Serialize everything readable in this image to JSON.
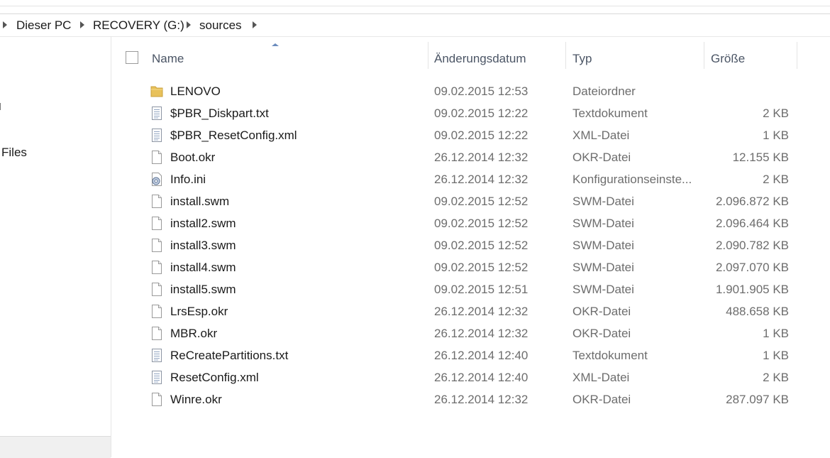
{
  "breadcrumb": [
    "Dieser PC",
    "RECOVERY (G:)",
    "sources"
  ],
  "nav": {
    "files_label": "Files"
  },
  "columns": {
    "name": "Name",
    "date": "Änderungsdatum",
    "type": "Typ",
    "size": "Größe"
  },
  "files": [
    {
      "name": "LENOVO",
      "date": "09.02.2015 12:53",
      "type": "Dateiordner",
      "size": "",
      "icon": "folder-icon"
    },
    {
      "name": "$PBR_Diskpart.txt",
      "date": "09.02.2015 12:22",
      "type": "Textdokument",
      "size": "2 KB",
      "icon": "text-file-icon"
    },
    {
      "name": "$PBR_ResetConfig.xml",
      "date": "09.02.2015 12:22",
      "type": "XML-Datei",
      "size": "1 KB",
      "icon": "text-file-icon"
    },
    {
      "name": "Boot.okr",
      "date": "26.12.2014 12:32",
      "type": "OKR-Datei",
      "size": "12.155 KB",
      "icon": "file-icon"
    },
    {
      "name": "Info.ini",
      "date": "26.12.2014 12:32",
      "type": "Konfigurationseinste...",
      "size": "2 KB",
      "icon": "settings-file-icon"
    },
    {
      "name": "install.swm",
      "date": "09.02.2015 12:52",
      "type": "SWM-Datei",
      "size": "2.096.872 KB",
      "icon": "file-icon"
    },
    {
      "name": "install2.swm",
      "date": "09.02.2015 12:52",
      "type": "SWM-Datei",
      "size": "2.096.464 KB",
      "icon": "file-icon"
    },
    {
      "name": "install3.swm",
      "date": "09.02.2015 12:52",
      "type": "SWM-Datei",
      "size": "2.090.782 KB",
      "icon": "file-icon"
    },
    {
      "name": "install4.swm",
      "date": "09.02.2015 12:52",
      "type": "SWM-Datei",
      "size": "2.097.070 KB",
      "icon": "file-icon"
    },
    {
      "name": "install5.swm",
      "date": "09.02.2015 12:51",
      "type": "SWM-Datei",
      "size": "1.901.905 KB",
      "icon": "file-icon"
    },
    {
      "name": "LrsEsp.okr",
      "date": "26.12.2014 12:32",
      "type": "OKR-Datei",
      "size": "488.658 KB",
      "icon": "file-icon"
    },
    {
      "name": "MBR.okr",
      "date": "26.12.2014 12:32",
      "type": "OKR-Datei",
      "size": "1 KB",
      "icon": "file-icon"
    },
    {
      "name": "ReCreatePartitions.txt",
      "date": "26.12.2014 12:40",
      "type": "Textdokument",
      "size": "1 KB",
      "icon": "text-file-icon"
    },
    {
      "name": "ResetConfig.xml",
      "date": "26.12.2014 12:40",
      "type": "XML-Datei",
      "size": "2 KB",
      "icon": "text-file-icon"
    },
    {
      "name": "Winre.okr",
      "date": "26.12.2014 12:32",
      "type": "OKR-Datei",
      "size": "287.097 KB",
      "icon": "file-icon"
    }
  ],
  "colors": {
    "folder": "#e8c15a",
    "header_text": "#4b5565",
    "secondary_text": "#6d6d6d"
  }
}
